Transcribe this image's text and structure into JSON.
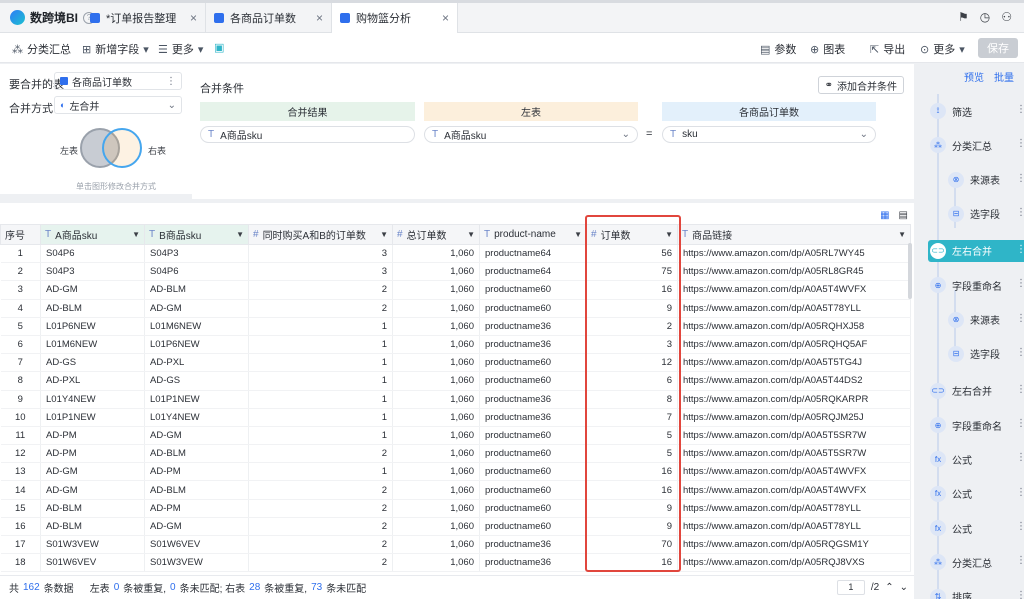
{
  "app": {
    "name": "数跨境BI",
    "help_icon": "question-circle-icon"
  },
  "tabs": [
    {
      "label": "*订单报告整理",
      "active": false
    },
    {
      "label": "各商品订单数",
      "active": false
    },
    {
      "label": "购物篮分析",
      "active": true
    }
  ],
  "toolbar": {
    "group_summary": "分类汇总",
    "new_field": "新增字段",
    "more": "更多",
    "params": "参数",
    "chart": "图表",
    "export": "导出",
    "more_right": "更多",
    "save": "保存"
  },
  "merge_config": {
    "table_label": "要合并的表",
    "table_value": "各商品订单数",
    "method_label": "合并方式",
    "method_value": "左合并",
    "venn_left": "左表",
    "venn_right": "右表",
    "venn_hint": "单击图形修改合并方式",
    "conditions_title": "合并条件",
    "add_condition": "添加合并条件",
    "col_result": "合并结果",
    "col_left": "左表",
    "col_right": "各商品订单数",
    "result_field": "A商品sku",
    "left_field": "A商品sku",
    "equals": "=",
    "right_field": "sku"
  },
  "grid": {
    "columns": [
      {
        "label": "序号",
        "type": ""
      },
      {
        "label": "A商品sku",
        "type": "T"
      },
      {
        "label": "B商品sku",
        "type": "T"
      },
      {
        "label": "同时购买A和B的订单数",
        "type": "#"
      },
      {
        "label": "总订单数",
        "type": "#"
      },
      {
        "label": "product-name",
        "type": "T"
      },
      {
        "label": "订单数",
        "type": "#"
      },
      {
        "label": "商品链接",
        "type": "T"
      }
    ],
    "rows": [
      [
        "1",
        "S04P6",
        "S04P3",
        "3",
        "1,060",
        "productname64",
        "56",
        "https://www.amazon.com/dp/A05RL7WY45"
      ],
      [
        "2",
        "S04P3",
        "S04P6",
        "3",
        "1,060",
        "productname64",
        "75",
        "https://www.amazon.com/dp/A05RL8GR45"
      ],
      [
        "3",
        "AD-GM",
        "AD-BLM",
        "2",
        "1,060",
        "productname60",
        "16",
        "https://www.amazon.com/dp/A0A5T4WVFX"
      ],
      [
        "4",
        "AD-BLM",
        "AD-GM",
        "2",
        "1,060",
        "productname60",
        "9",
        "https://www.amazon.com/dp/A0A5T78YLL"
      ],
      [
        "5",
        "L01P6NEW",
        "L01M6NEW",
        "1",
        "1,060",
        "productname36",
        "2",
        "https://www.amazon.com/dp/A05RQHXJ58"
      ],
      [
        "6",
        "L01M6NEW",
        "L01P6NEW",
        "1",
        "1,060",
        "productname36",
        "3",
        "https://www.amazon.com/dp/A05RQHQ5AF"
      ],
      [
        "7",
        "AD-GS",
        "AD-PXL",
        "1",
        "1,060",
        "productname60",
        "12",
        "https://www.amazon.com/dp/A0A5T5TG4J"
      ],
      [
        "8",
        "AD-PXL",
        "AD-GS",
        "1",
        "1,060",
        "productname60",
        "6",
        "https://www.amazon.com/dp/A0A5T44DS2"
      ],
      [
        "9",
        "L01Y4NEW",
        "L01P1NEW",
        "1",
        "1,060",
        "productname36",
        "8",
        "https://www.amazon.com/dp/A05RQKARPR"
      ],
      [
        "10",
        "L01P1NEW",
        "L01Y4NEW",
        "1",
        "1,060",
        "productname36",
        "7",
        "https://www.amazon.com/dp/A05RQJM25J"
      ],
      [
        "11",
        "AD-PM",
        "AD-GM",
        "1",
        "1,060",
        "productname60",
        "5",
        "https://www.amazon.com/dp/A0A5T5SR7W"
      ],
      [
        "12",
        "AD-PM",
        "AD-BLM",
        "2",
        "1,060",
        "productname60",
        "5",
        "https://www.amazon.com/dp/A0A5T5SR7W"
      ],
      [
        "13",
        "AD-GM",
        "AD-PM",
        "1",
        "1,060",
        "productname60",
        "16",
        "https://www.amazon.com/dp/A0A5T4WVFX"
      ],
      [
        "14",
        "AD-GM",
        "AD-BLM",
        "2",
        "1,060",
        "productname60",
        "16",
        "https://www.amazon.com/dp/A0A5T4WVFX"
      ],
      [
        "15",
        "AD-BLM",
        "AD-PM",
        "2",
        "1,060",
        "productname60",
        "9",
        "https://www.amazon.com/dp/A0A5T78YLL"
      ],
      [
        "16",
        "AD-BLM",
        "AD-GM",
        "2",
        "1,060",
        "productname60",
        "9",
        "https://www.amazon.com/dp/A0A5T78YLL"
      ],
      [
        "17",
        "S01W3VEW",
        "S01W6VEV",
        "2",
        "1,060",
        "productname36",
        "70",
        "https://www.amazon.com/dp/A05RQGSM1Y"
      ],
      [
        "18",
        "S01W6VEV",
        "S01W3VEW",
        "2",
        "1,060",
        "productname36",
        "16",
        "https://www.amazon.com/dp/A05RQJ8VXS"
      ]
    ]
  },
  "footer": {
    "total_prefix": "共",
    "total_count": "162",
    "total_suffix": "条数据",
    "left_prefix": "左表",
    "left_dup": "0",
    "left_dup_text": "条被重复,",
    "left_unmatched": "0",
    "left_unmatched_text": "条未匹配; 右表",
    "right_dup": "28",
    "right_dup_text": "条被重复,",
    "right_unmatched": "73",
    "right_unmatched_text": "条未匹配",
    "page_current": "1",
    "page_total": "/2"
  },
  "steps": {
    "preview": "预览",
    "batch": "批量",
    "items": [
      {
        "label": "筛选",
        "level": 0,
        "icon": "filter-icon"
      },
      {
        "label": "分类汇总",
        "level": 0,
        "icon": "group-icon"
      },
      {
        "label": "来源表",
        "level": 1,
        "icon": "source-icon"
      },
      {
        "label": "选字段",
        "level": 1,
        "icon": "field-icon"
      },
      {
        "label": "左右合并",
        "level": 0,
        "icon": "merge-icon",
        "active": true
      },
      {
        "label": "字段重命名",
        "level": 0,
        "icon": "rename-icon"
      },
      {
        "label": "来源表",
        "level": 1,
        "icon": "source-icon"
      },
      {
        "label": "选字段",
        "level": 1,
        "icon": "field-icon"
      },
      {
        "label": "左右合并",
        "level": 0,
        "icon": "merge-icon"
      },
      {
        "label": "字段重命名",
        "level": 0,
        "icon": "rename-icon"
      },
      {
        "label": "公式",
        "level": 0,
        "icon": "formula-icon"
      },
      {
        "label": "公式",
        "level": 0,
        "icon": "formula-icon"
      },
      {
        "label": "公式",
        "level": 0,
        "icon": "formula-icon"
      },
      {
        "label": "分类汇总",
        "level": 0,
        "icon": "group-icon"
      },
      {
        "label": "排序",
        "level": 0,
        "icon": "sort-icon"
      }
    ]
  },
  "colors": {
    "accent": "#2f6fed",
    "active_step": "#2fb5c8",
    "highlight_box": "#e1463d"
  }
}
